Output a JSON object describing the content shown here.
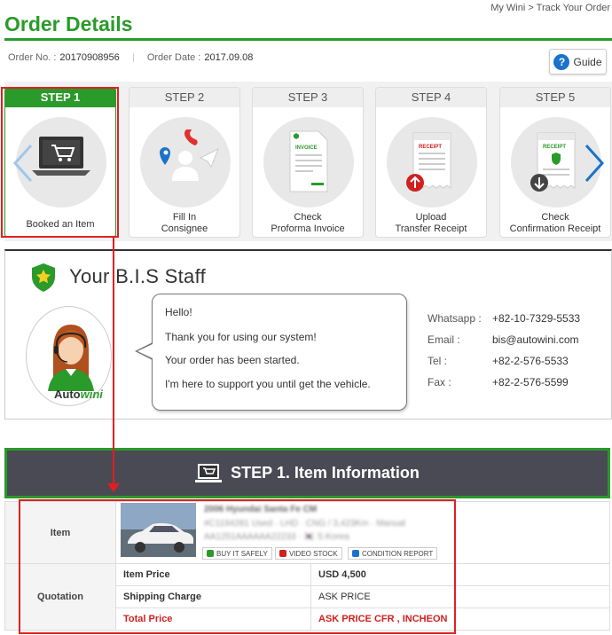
{
  "header": {
    "breadcrumb": "My Wini > Track Your Order",
    "title": "Order Details",
    "order_no_label": "Order No. :",
    "order_no": "20170908956",
    "order_date_label": "Order Date :",
    "order_date": "2017.09.08",
    "guide_label": "Guide"
  },
  "steps": [
    {
      "head": "STEP 1",
      "label_lines": [
        "Booked an Item"
      ],
      "active": true
    },
    {
      "head": "STEP 2",
      "label_lines": [
        "Fill In",
        "Consignee"
      ],
      "active": false
    },
    {
      "head": "STEP 3",
      "label_lines": [
        "Check",
        "Proforma Invoice"
      ],
      "active": false
    },
    {
      "head": "STEP 4",
      "label_lines": [
        "Upload",
        "Transfer Receipt"
      ],
      "active": false
    },
    {
      "head": "STEP 5",
      "label_lines": [
        "Check",
        "Confirmation Receipt"
      ],
      "active": false
    }
  ],
  "staff": {
    "title": "Your B.I.S Staff",
    "brand_a": "Auto",
    "brand_b": "wini",
    "messages": [
      "Hello!",
      "Thank you for using our system!",
      "Your order has been started.",
      "I'm here to support you until get the vehicle."
    ],
    "contacts": [
      {
        "key": "Whatsapp :",
        "value": "+82-10-7329-5533"
      },
      {
        "key": "Email :",
        "value": "bis@autowini.com"
      },
      {
        "key": "Tel :",
        "value": "+82-2-576-5533"
      },
      {
        "key": "Fax :",
        "value": "+82-2-576-5599"
      }
    ]
  },
  "item_section": {
    "banner": "STEP 1. Item Information",
    "item_label": "Item",
    "item_lines": [
      "2006 Hyundai Santa Fe CM",
      "#C1194281 Used · LHD · CNG / 3,423Km · Manual",
      "AA1251AAAAAA22233 · 🇰🇷 S.Korea"
    ],
    "tags": [
      "BUY IT SAFELY",
      "VIDEO STOCK",
      "CONDITION REPORT"
    ],
    "quotation_label": "Quotation",
    "rows": [
      {
        "key": "Item Price",
        "value": "USD 4,500"
      },
      {
        "key": "Shipping Charge",
        "value": "ASK PRICE"
      },
      {
        "key": "Total Price",
        "value": "ASK PRICE   CFR , INCHEON"
      }
    ]
  },
  "colors": {
    "brand_green": "#2a9a2a",
    "highlight_red": "#e02020",
    "banner_bg": "#4a4a55",
    "link_blue": "#1a73c9"
  }
}
